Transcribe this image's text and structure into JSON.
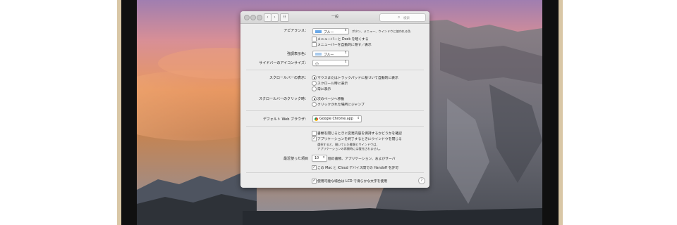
{
  "window": {
    "title": "一般",
    "search_placeholder": "検索",
    "back": "‹",
    "forward": "›"
  },
  "appearance": {
    "label": "アピアランス：",
    "value": "ブルー",
    "description": "ボタン、メニュー、ウインドウに使われる色",
    "options": [
      {
        "label": "メニューバーと Dock を暗くする",
        "checked": false
      },
      {
        "label": "メニューバーを自動的に隠す／表示",
        "checked": false
      }
    ]
  },
  "highlight": {
    "label": "強調表示色：",
    "value": "ブルー"
  },
  "sidebar_icon": {
    "label": "サイドバーのアイコンサイズ：",
    "value": "小"
  },
  "show_scrollbars": {
    "label": "スクロールバーの表示：",
    "options": [
      {
        "label": "マウスまたはトラックパッドに基づいて自動的に表示",
        "selected": true
      },
      {
        "label": "スクロール時に表示",
        "selected": false
      },
      {
        "label": "常に表示",
        "selected": false
      }
    ]
  },
  "click_scrollbar": {
    "label": "スクロールバーのクリック時：",
    "options": [
      {
        "label": "次のページへ移動",
        "selected": true
      },
      {
        "label": "クリックされた場所にジャンプ",
        "selected": false
      }
    ]
  },
  "browser": {
    "label": "デフォルト Web ブラウザ：",
    "value": "Google Chrome.app"
  },
  "documents": {
    "options": [
      {
        "label": "書類を閉じるときに変更内容を保持するかどうかを確認",
        "checked": false
      },
      {
        "label": "アプリケーションを終了するときにウインドウを閉じる",
        "checked": true
      }
    ],
    "note_line1": "選択すると、開いていた書類とウインドウは、",
    "note_line2": "アプリケーションの再開時には復元されません。"
  },
  "recent": {
    "label": "最近使った項目",
    "value": "10",
    "suffix": "個の書類、アプリケーション、およびサーバ"
  },
  "handoff": {
    "label": "この Mac と iCloud デバイス間での Handoff を許可",
    "checked": true
  },
  "lcd": {
    "label": "使用可能な場合は LCD で滑らかな文字を使用",
    "checked": true
  },
  "help": "?",
  "colors": {
    "accent_swatch": "#6aa8e8",
    "window_bg": "#ececec"
  }
}
